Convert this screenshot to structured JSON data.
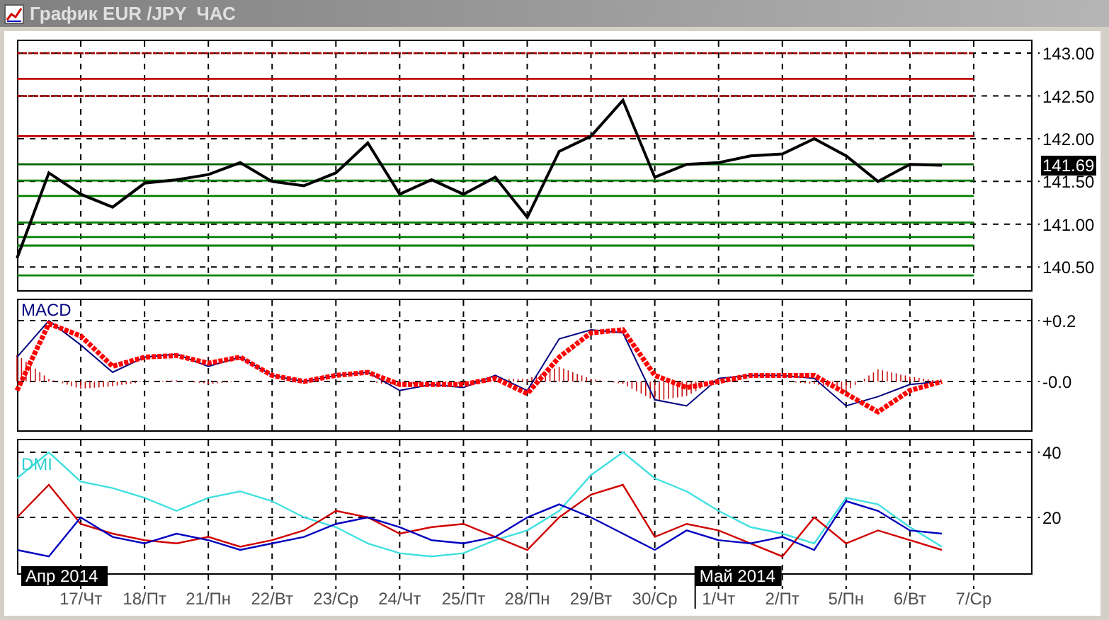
{
  "window": {
    "title": "График EUR /JPY  ЧАС"
  },
  "price_panel": {
    "current_price": "141.69",
    "chart_data": {
      "type": "line",
      "grid": true,
      "ylim": [
        140.22,
        143.15
      ],
      "categories": [
        null,
        null,
        null,
        null,
        null,
        null,
        null,
        null,
        null,
        null,
        null,
        null,
        null,
        null,
        null,
        null,
        null,
        null,
        null,
        null,
        null,
        null,
        null,
        null,
        null,
        null,
        null,
        null,
        null,
        null,
        null
      ],
      "yticks": [
        {
          "value": 143,
          "label": "143.00"
        },
        {
          "value": 142.5,
          "label": "142.50"
        },
        {
          "value": 142,
          "label": "142.00"
        },
        {
          "value": 141.5,
          "label": "141.50"
        },
        {
          "value": 141,
          "label": "141.00"
        },
        {
          "value": 140.5,
          "label": "140.50"
        }
      ],
      "series": [
        {
          "color": "#a00000",
          "line_style": "dashed",
          "values": [
            143,
            143,
            143,
            143,
            143,
            143,
            143,
            143,
            143,
            143,
            143,
            143,
            143,
            143,
            143,
            143,
            143,
            143,
            143,
            143,
            143,
            143,
            143,
            143,
            143,
            143,
            143,
            143,
            143,
            143,
            143
          ]
        },
        {
          "color": "#c00000",
          "values": [
            142.7,
            142.7,
            142.7,
            142.7,
            142.7,
            142.7,
            142.7,
            142.7,
            142.7,
            142.7,
            142.7,
            142.7,
            142.7,
            142.7,
            142.7,
            142.7,
            142.7,
            142.7,
            142.7,
            142.7,
            142.7,
            142.7,
            142.7,
            142.7,
            142.7,
            142.7,
            142.7,
            142.7,
            142.7,
            142.7,
            142.7
          ]
        },
        {
          "color": "#a00000",
          "line_style": "dashed",
          "values": [
            142.5,
            142.5,
            142.5,
            142.5,
            142.5,
            142.5,
            142.5,
            142.5,
            142.5,
            142.5,
            142.5,
            142.5,
            142.5,
            142.5,
            142.5,
            142.5,
            142.5,
            142.5,
            142.5,
            142.5,
            142.5,
            142.5,
            142.5,
            142.5,
            142.5,
            142.5,
            142.5,
            142.5,
            142.5,
            142.5,
            142.5
          ]
        },
        {
          "color": "#c00000",
          "values": [
            142.03,
            142.03,
            142.03,
            142.03,
            142.03,
            142.03,
            142.03,
            142.03,
            142.03,
            142.03,
            142.03,
            142.03,
            142.03,
            142.03,
            142.03,
            142.03,
            142.03,
            142.03,
            142.03,
            142.03,
            142.03,
            142.03,
            142.03,
            142.03,
            142.03,
            142.03,
            142.03,
            142.03,
            142.03,
            142.03,
            142.03
          ]
        },
        {
          "color": "#006000",
          "values": [
            141.7,
            141.7,
            141.7,
            141.7,
            141.7,
            141.7,
            141.7,
            141.7,
            141.7,
            141.7,
            141.7,
            141.7,
            141.7,
            141.7,
            141.7,
            141.7,
            141.7,
            141.7,
            141.7,
            141.7,
            141.7,
            141.7,
            141.7,
            141.7,
            141.7,
            141.7,
            141.7,
            141.7,
            141.7,
            141.7,
            141.7
          ]
        },
        {
          "color": "#008000",
          "values": [
            141.51,
            141.51,
            141.51,
            141.51,
            141.51,
            141.51,
            141.51,
            141.51,
            141.51,
            141.51,
            141.51,
            141.51,
            141.51,
            141.51,
            141.51,
            141.51,
            141.51,
            141.51,
            141.51,
            141.51,
            141.51,
            141.51,
            141.51,
            141.51,
            141.51,
            141.51,
            141.51,
            141.51,
            141.51,
            141.51,
            141.51
          ]
        },
        {
          "color": "#008000",
          "values": [
            141.33,
            141.33,
            141.33,
            141.33,
            141.33,
            141.33,
            141.33,
            141.33,
            141.33,
            141.33,
            141.33,
            141.33,
            141.33,
            141.33,
            141.33,
            141.33,
            141.33,
            141.33,
            141.33,
            141.33,
            141.33,
            141.33,
            141.33,
            141.33,
            141.33,
            141.33,
            141.33,
            141.33,
            141.33,
            141.33,
            141.33
          ]
        },
        {
          "color": "#008000",
          "values": [
            141.02,
            141.02,
            141.02,
            141.02,
            141.02,
            141.02,
            141.02,
            141.02,
            141.02,
            141.02,
            141.02,
            141.02,
            141.02,
            141.02,
            141.02,
            141.02,
            141.02,
            141.02,
            141.02,
            141.02,
            141.02,
            141.02,
            141.02,
            141.02,
            141.02,
            141.02,
            141.02,
            141.02,
            141.02,
            141.02,
            141.02
          ]
        },
        {
          "color": "#008000",
          "values": [
            140.85,
            140.85,
            140.85,
            140.85,
            140.85,
            140.85,
            140.85,
            140.85,
            140.85,
            140.85,
            140.85,
            140.85,
            140.85,
            140.85,
            140.85,
            140.85,
            140.85,
            140.85,
            140.85,
            140.85,
            140.85,
            140.85,
            140.85,
            140.85,
            140.85,
            140.85,
            140.85,
            140.85,
            140.85,
            140.85,
            140.85
          ]
        },
        {
          "color": "#008000",
          "values": [
            140.75,
            140.75,
            140.75,
            140.75,
            140.75,
            140.75,
            140.75,
            140.75,
            140.75,
            140.75,
            140.75,
            140.75,
            140.75,
            140.75,
            140.75,
            140.75,
            140.75,
            140.75,
            140.75,
            140.75,
            140.75,
            140.75,
            140.75,
            140.75,
            140.75,
            140.75,
            140.75,
            140.75,
            140.75,
            140.75,
            140.75
          ]
        },
        {
          "color": "#008000",
          "values": [
            140.4,
            140.4,
            140.4,
            140.4,
            140.4,
            140.4,
            140.4,
            140.4,
            140.4,
            140.4,
            140.4,
            140.4,
            140.4,
            140.4,
            140.4,
            140.4,
            140.4,
            140.4,
            140.4,
            140.4,
            140.4,
            140.4,
            140.4,
            140.4,
            140.4,
            140.4,
            140.4,
            140.4,
            140.4,
            140.4,
            140.4
          ]
        },
        {
          "color": "#000000",
          "values": [
            140.6,
            141.6,
            141.35,
            141.2,
            141.48,
            141.52,
            141.58,
            141.72,
            141.5,
            141.45,
            141.6,
            141.95,
            141.35,
            141.52,
            141.35,
            141.55,
            141.08,
            141.85,
            142.03,
            142.45,
            141.55,
            141.7,
            141.72,
            141.8,
            141.82,
            142.0,
            141.8,
            141.5,
            141.7,
            141.69,
            null
          ]
        }
      ]
    }
  },
  "macd_panel": {
    "chart_data": {
      "type": "line",
      "grid": true,
      "title": "MACD",
      "ylim": [
        -0.163,
        0.27
      ],
      "categories": [
        null,
        null,
        null,
        null,
        null,
        null,
        null,
        null,
        null,
        null,
        null,
        null,
        null,
        null,
        null,
        null,
        null,
        null,
        null,
        null,
        null,
        null,
        null,
        null,
        null,
        null,
        null,
        null,
        null,
        null,
        null
      ],
      "yticks": [
        {
          "value": 0.2,
          "label": "+0.2"
        },
        {
          "value": 0,
          "label": "-0.0"
        }
      ],
      "series": [
        {
          "color": "#000080",
          "values": [
            0.08,
            0.2,
            0.12,
            0.03,
            0.08,
            0.09,
            0.05,
            0.08,
            0.02,
            0,
            0.02,
            0.03,
            -0.03,
            -0.01,
            -0.02,
            0.02,
            -0.03,
            0.14,
            0.17,
            0.16,
            -0.06,
            -0.08,
            0.01,
            0.02,
            0.02,
            0.01,
            -0.08,
            -0.05,
            -0.01,
            0.0,
            null
          ]
        },
        {
          "color": "#ff0000",
          "line_style": "dashed",
          "values": [
            -0.03,
            0.19,
            0.15,
            0.05,
            0.08,
            0.085,
            0.06,
            0.08,
            0.02,
            0.0,
            0.02,
            0.03,
            -0.01,
            -0.01,
            -0.01,
            0.01,
            -0.04,
            0.08,
            0.16,
            0.17,
            0.02,
            -0.02,
            0.0,
            0.02,
            0.02,
            0.02,
            -0.04,
            -0.1,
            -0.03,
            0.0,
            null
          ]
        }
      ]
    }
  },
  "dmi_panel": {
    "chart_data": {
      "type": "line",
      "grid": true,
      "title": "DMI",
      "ylim": [
        2.6,
        43.9
      ],
      "categories": [
        null,
        null,
        "17/Чт",
        null,
        "18/Пт",
        null,
        "21/Пн",
        null,
        "22/Вт",
        null,
        "23/Ср",
        null,
        "24/Чт",
        null,
        "25/Пт",
        null,
        "28/Пн",
        null,
        "29/Вт",
        null,
        "30/Ср",
        null,
        "1/Чт",
        null,
        "2/Пт",
        null,
        "5/Пн",
        null,
        "6/Вт",
        null,
        "7/Ср"
      ],
      "yticks": [
        {
          "value": 40,
          "label": "40"
        },
        {
          "value": 20,
          "label": "20"
        }
      ],
      "series": [
        {
          "color": "#40e0e0",
          "values": [
            32,
            40,
            31,
            29,
            26,
            22,
            26,
            28,
            25,
            20,
            17,
            12,
            9,
            8,
            9,
            13,
            16,
            22,
            33,
            40,
            32,
            28,
            22,
            17,
            15,
            12,
            26,
            24,
            17,
            11,
            null
          ]
        },
        {
          "color": "#d00000",
          "values": [
            20,
            30,
            18,
            15,
            13,
            12,
            14,
            11,
            13,
            16,
            22,
            20,
            15,
            17,
            18,
            14,
            10,
            20,
            27,
            30,
            14,
            18,
            16,
            12,
            8,
            20,
            12,
            16,
            13,
            10,
            null
          ]
        },
        {
          "color": "#0000c0",
          "values": [
            10,
            8,
            20,
            14,
            12,
            15,
            13,
            10,
            12,
            14,
            18,
            20,
            17,
            13,
            12,
            14,
            20,
            24,
            20,
            15,
            10,
            16,
            13,
            12,
            14,
            10,
            25,
            22,
            16,
            15,
            null
          ]
        }
      ],
      "annotations": [
        "Апр 2014",
        "Май 2014"
      ]
    }
  }
}
